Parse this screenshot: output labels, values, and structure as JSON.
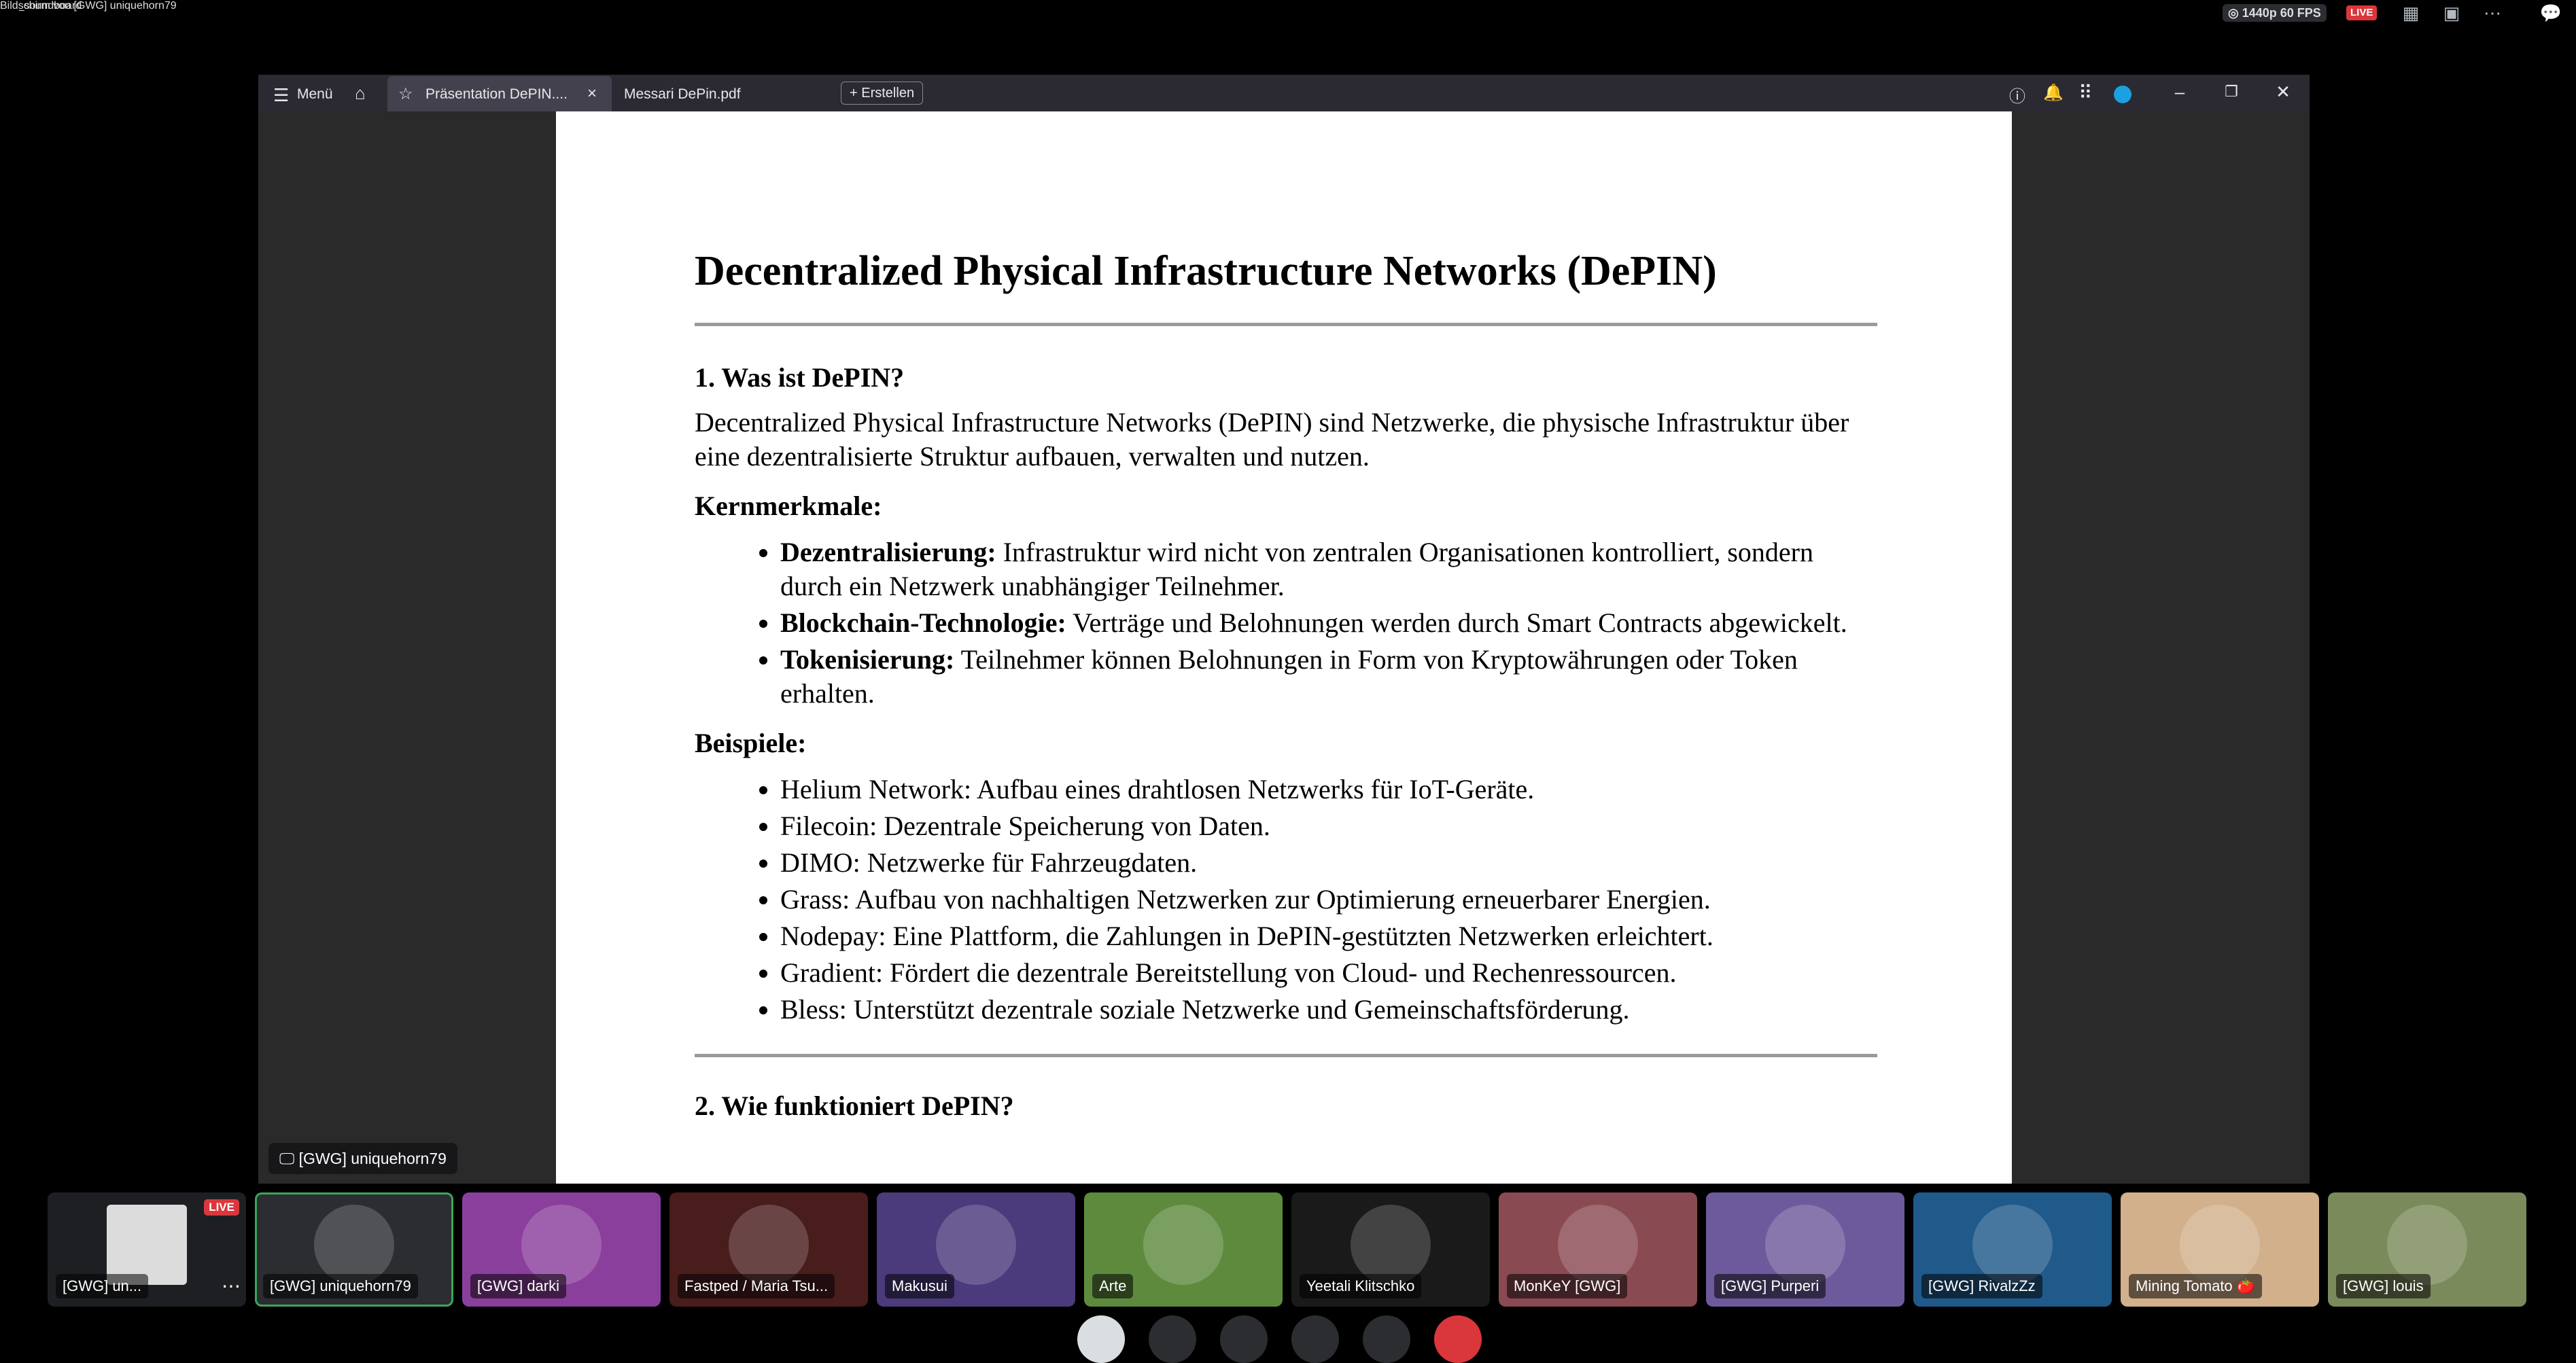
{
  "topbar": {
    "channel": "#no_soundboard",
    "screen_title": "Bildschirm von [GWG] uniquehorn79",
    "quality": "◎ 1440p 60 FPS",
    "live": "LIVE"
  },
  "viewer": {
    "menu_label": "Menü",
    "tabs": [
      {
        "label": "Präsentation DePIN...."
      },
      {
        "label": "Messari DePin.pdf"
      }
    ],
    "create_label": "Erstellen"
  },
  "doc": {
    "title": "Decentralized Physical Infrastructure Networks (DePIN)",
    "section1_heading": "1. Was ist DePIN?",
    "intro": "Decentralized Physical Infrastructure Networks (DePIN) sind Netzwerke, die physische Infrastruktur über eine dezentralisierte Struktur aufbauen, verwalten und nutzen.",
    "features_heading": "Kernmerkmale:",
    "features": [
      {
        "term": "Dezentralisierung:",
        "text": " Infrastruktur wird nicht von zentralen Organisationen kontrolliert, sondern durch ein Netzwerk unabhängiger Teilnehmer."
      },
      {
        "term": "Blockchain-Technologie:",
        "text": " Verträge und Belohnungen werden durch Smart Contracts abgewickelt."
      },
      {
        "term": "Tokenisierung:",
        "text": " Teilnehmer können Belohnungen in Form von Kryptowährungen oder Token erhalten."
      }
    ],
    "examples_heading": "Beispiele:",
    "examples": [
      "Helium Network: Aufbau eines drahtlosen Netzwerks für IoT-Geräte.",
      "Filecoin: Dezentrale Speicherung von Daten.",
      "DIMO: Netzwerke für Fahrzeugdaten.",
      "Grass: Aufbau von nachhaltigen Netzwerken zur Optimierung erneuerbarer Energien.",
      "Nodepay: Eine Plattform, die Zahlungen in DePIN-gestützten Netzwerken erleichtert.",
      "Gradient: Fördert die dezentrale Bereitstellung von Cloud- und Rechenressourcen.",
      "Bless: Unterstützt dezentrale soziale Netzwerke und Gemeinschaftsförderung."
    ],
    "section2_heading": "2. Wie funktioniert DePIN?"
  },
  "presenter_label": "[GWG] uniquehorn79",
  "participants": [
    {
      "name": "[GWG] un...",
      "bg": "#1e1f22",
      "live": "LIVE"
    },
    {
      "name": "[GWG] uniquehorn79",
      "bg": "#2b2d31"
    },
    {
      "name": "[GWG] darki",
      "bg": "#8a3f9c"
    },
    {
      "name": "Fastped / Maria Tsu...",
      "bg": "#4a1d1d"
    },
    {
      "name": "Makusui",
      "bg": "#4b3a7c"
    },
    {
      "name": "Arte",
      "bg": "#5e8a3e"
    },
    {
      "name": "Yeetali Klitschko",
      "bg": "#1a1a1a"
    },
    {
      "name": "MonKeY [GWG]",
      "bg": "#8a4a52"
    },
    {
      "name": "[GWG] Purperi",
      "bg": "#6d5a9c"
    },
    {
      "name": "[GWG] RivalzZz",
      "bg": "#1f5a8a"
    },
    {
      "name": "Mining Tomato 🍅",
      "bg": "#d2b08c"
    },
    {
      "name": "[GWG] louis",
      "bg": "#7a8a5a"
    }
  ],
  "colors": {
    "live_red": "#da373c",
    "speaking_green": "#3ba55d"
  }
}
